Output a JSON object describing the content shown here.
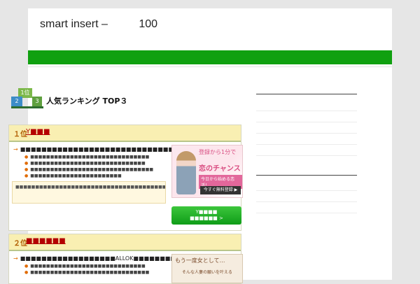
{
  "site": {
    "title": "smart insert –          100"
  },
  "ranking": {
    "title": "人気ランキング TOP３",
    "podium": [
      "1位",
      "2",
      "3"
    ]
  },
  "cards": [
    {
      "num": "１位",
      "name": "Y■■■",
      "lead": "■■■■■■■■■■■■■■■■■■■■■■■■■■■■■■■",
      "bullets": [
        "■■■■■■■■■■■■■■■■■■■■■■■■■■■■■■",
        "■■■■■■■■■■■■■■■■■■■■■■■■■■■■■",
        "■■■■■■■■■■■■■■■■■■■■■■■■■■■■■■■",
        "■■■■■■■■■■■■■■■■■■■■■■■"
      ],
      "note": "■■■■■■■■■■■■■■■■■■■■■■■■■■■■■■■■■■■■■■■■■■■■■■■■■■■■■■■■■■■■■■■■■■■■■■■■■■■■■■■■■■■■■■■■■■■■■■■■■■■■",
      "banner": {
        "line1": "登録から1分で",
        "line2": "恋のチャンス",
        "line3": "今日から始める恋活！",
        "button": "今すぐ無料登録 ▶"
      },
      "cta": {
        "line1": "Y■■■■",
        "line2": "■■■■■■ >"
      }
    },
    {
      "num": "２位",
      "name": "■■■■■■",
      "lead": "■■■■■■■■■■■■■■■■■■ALLOK■■■■■■■■",
      "bullets": [
        "■■■■■■■■■■■■■■■■■■■■■■■■■■■■■",
        "■■■■■■■■■■■■■■■■■■■■■■■■■■■■■■"
      ],
      "banner": {
        "line1": "もう一度女として…",
        "line2": "そんな人妻の願いを叶える"
      }
    }
  ],
  "colors": {
    "nav": "#10a010",
    "card_header": "#f9efb2",
    "cta": "#11a61a"
  }
}
